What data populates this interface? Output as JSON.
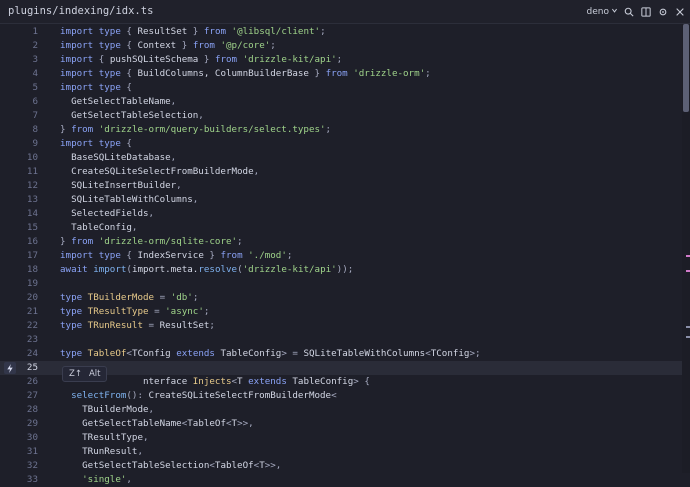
{
  "titlebar": {
    "path": "plugins/indexing/idx.ts",
    "runtime_label": "deno",
    "icons": [
      "chevron-down-icon",
      "search-icon",
      "split-icon",
      "settings-icon",
      "close-icon"
    ]
  },
  "editor": {
    "current_line": 25,
    "lines": [
      {
        "num": "1",
        "t": [
          [
            "kw",
            "import type "
          ],
          [
            "punc",
            "{ "
          ],
          [
            "",
            "ResultSet "
          ],
          [
            "punc",
            "} "
          ],
          [
            "kw",
            "from "
          ],
          [
            "str",
            "'@libsql/client'"
          ],
          [
            "punc",
            ";"
          ]
        ]
      },
      {
        "num": "2",
        "t": [
          [
            "kw",
            "import type "
          ],
          [
            "punc",
            "{ "
          ],
          [
            "",
            "Context "
          ],
          [
            "punc",
            "} "
          ],
          [
            "kw",
            "from "
          ],
          [
            "str",
            "'@p/core'"
          ],
          [
            "punc",
            ";"
          ]
        ]
      },
      {
        "num": "3",
        "t": [
          [
            "kw",
            "import "
          ],
          [
            "punc",
            "{ "
          ],
          [
            "",
            "pushSQLiteSchema "
          ],
          [
            "punc",
            "} "
          ],
          [
            "kw",
            "from "
          ],
          [
            "str",
            "'drizzle-kit/api'"
          ],
          [
            "punc",
            ";"
          ]
        ]
      },
      {
        "num": "4",
        "t": [
          [
            "kw",
            "import type "
          ],
          [
            "punc",
            "{ "
          ],
          [
            "",
            "BuildColumns, ColumnBuilderBase "
          ],
          [
            "punc",
            "} "
          ],
          [
            "kw",
            "from "
          ],
          [
            "str",
            "'drizzle-orm'"
          ],
          [
            "punc",
            ";"
          ]
        ]
      },
      {
        "num": "5",
        "t": [
          [
            "kw",
            "import type "
          ],
          [
            "punc",
            "{"
          ]
        ]
      },
      {
        "num": "6",
        "t": [
          [
            "",
            "  GetSelectTableName"
          ],
          [
            "punc",
            ","
          ]
        ]
      },
      {
        "num": "7",
        "t": [
          [
            "",
            "  GetSelectTableSelection"
          ],
          [
            "punc",
            ","
          ]
        ]
      },
      {
        "num": "8",
        "t": [
          [
            "punc",
            "} "
          ],
          [
            "kw",
            "from "
          ],
          [
            "str",
            "'drizzle-orm/query-builders/select.types'"
          ],
          [
            "punc",
            ";"
          ]
        ]
      },
      {
        "num": "9",
        "t": [
          [
            "kw",
            "import type "
          ],
          [
            "punc",
            "{"
          ]
        ]
      },
      {
        "num": "10",
        "t": [
          [
            "",
            "  BaseSQLiteDatabase"
          ],
          [
            "punc",
            ","
          ]
        ]
      },
      {
        "num": "11",
        "t": [
          [
            "",
            "  CreateSQLiteSelectFromBuilderMode"
          ],
          [
            "punc",
            ","
          ]
        ]
      },
      {
        "num": "12",
        "t": [
          [
            "",
            "  SQLiteInsertBuilder"
          ],
          [
            "punc",
            ","
          ]
        ]
      },
      {
        "num": "13",
        "t": [
          [
            "",
            "  SQLiteTableWithColumns"
          ],
          [
            "punc",
            ","
          ]
        ]
      },
      {
        "num": "14",
        "t": [
          [
            "",
            "  SelectedFields"
          ],
          [
            "punc",
            ","
          ]
        ]
      },
      {
        "num": "15",
        "t": [
          [
            "",
            "  TableConfig"
          ],
          [
            "punc",
            ","
          ]
        ]
      },
      {
        "num": "16",
        "t": [
          [
            "punc",
            "} "
          ],
          [
            "kw",
            "from "
          ],
          [
            "str",
            "'drizzle-orm/sqlite-core'"
          ],
          [
            "punc",
            ";"
          ]
        ]
      },
      {
        "num": "17",
        "t": [
          [
            "kw",
            "import type "
          ],
          [
            "punc",
            "{ "
          ],
          [
            "",
            "IndexService "
          ],
          [
            "punc",
            "} "
          ],
          [
            "kw",
            "from "
          ],
          [
            "str",
            "'./mod'"
          ],
          [
            "punc",
            ";"
          ]
        ]
      },
      {
        "num": "18",
        "t": [
          [
            "kw",
            "await "
          ],
          [
            "fn",
            "import"
          ],
          [
            "punc",
            "("
          ],
          [
            "",
            "import.meta."
          ],
          [
            "fn",
            "resolve"
          ],
          [
            "punc",
            "("
          ],
          [
            "str",
            "'drizzle-kit/api'"
          ],
          [
            "punc",
            "));"
          ]
        ]
      },
      {
        "num": "19",
        "t": []
      },
      {
        "num": "20",
        "t": [
          [
            "kw",
            "type "
          ],
          [
            "type",
            "TBuilderMode "
          ],
          [
            "punc",
            "= "
          ],
          [
            "str",
            "'db'"
          ],
          [
            "punc",
            ";"
          ]
        ]
      },
      {
        "num": "21",
        "t": [
          [
            "kw",
            "type "
          ],
          [
            "type",
            "TResultType "
          ],
          [
            "punc",
            "= "
          ],
          [
            "str",
            "'async'"
          ],
          [
            "punc",
            ";"
          ]
        ]
      },
      {
        "num": "22",
        "t": [
          [
            "kw",
            "type "
          ],
          [
            "type",
            "TRunResult "
          ],
          [
            "punc",
            "= "
          ],
          [
            "",
            "ResultSet"
          ],
          [
            "punc",
            ";"
          ]
        ]
      },
      {
        "num": "23",
        "t": []
      },
      {
        "num": "24",
        "t": [
          [
            "kw",
            "type "
          ],
          [
            "type",
            "TableOf"
          ],
          [
            "punc",
            "<"
          ],
          [
            "",
            "TConfig "
          ],
          [
            "kw",
            "extends "
          ],
          [
            "",
            "TableConfig"
          ],
          [
            "punc",
            "> = "
          ],
          [
            "",
            "SQLiteTableWithColumns"
          ],
          [
            "punc",
            "<"
          ],
          [
            "",
            "TConfig"
          ],
          [
            "punc",
            ">;"
          ]
        ]
      },
      {
        "num": "25",
        "t": []
      },
      {
        "num": "26",
        "t": [
          [
            "",
            "               nterface "
          ],
          [
            "type",
            "Injects"
          ],
          [
            "punc",
            "<"
          ],
          [
            "",
            "T "
          ],
          [
            "kw",
            "extends "
          ],
          [
            "",
            "TableConfig"
          ],
          [
            "punc",
            "> {"
          ]
        ]
      },
      {
        "num": "27",
        "t": [
          [
            "fn",
            "  selectFrom"
          ],
          [
            "punc",
            "(): "
          ],
          [
            "",
            "CreateSQLiteSelectFromBuilderMode"
          ],
          [
            "punc",
            "<"
          ]
        ]
      },
      {
        "num": "28",
        "t": [
          [
            "",
            "    TBuilderMode"
          ],
          [
            "punc",
            ","
          ]
        ]
      },
      {
        "num": "29",
        "t": [
          [
            "",
            "    GetSelectTableName"
          ],
          [
            "punc",
            "<"
          ],
          [
            "",
            "TableOf"
          ],
          [
            "punc",
            "<"
          ],
          [
            "",
            "T"
          ],
          [
            "punc",
            ">>,"
          ]
        ]
      },
      {
        "num": "30",
        "t": [
          [
            "",
            "    TResultType"
          ],
          [
            "punc",
            ","
          ]
        ]
      },
      {
        "num": "31",
        "t": [
          [
            "",
            "    TRunResult"
          ],
          [
            "punc",
            ","
          ]
        ]
      },
      {
        "num": "32",
        "t": [
          [
            "",
            "    GetSelectTableSelection"
          ],
          [
            "punc",
            "<"
          ],
          [
            "",
            "TableOf"
          ],
          [
            "punc",
            "<"
          ],
          [
            "",
            "T"
          ],
          [
            "punc",
            ">>,"
          ]
        ]
      },
      {
        "num": "33",
        "t": [
          [
            "str",
            "    'single'"
          ],
          [
            "punc",
            ","
          ]
        ]
      }
    ]
  },
  "inline_popup": {
    "shortcut_label": "Z↑",
    "action_label": "Alt"
  },
  "colors": {
    "background": "#1e1f29",
    "keyword": "#8aa2f5",
    "string": "#9fd38a",
    "type_name": "#e6c98a",
    "function": "#7fb2ef",
    "diagnostic_mark": "#d07ac8"
  }
}
